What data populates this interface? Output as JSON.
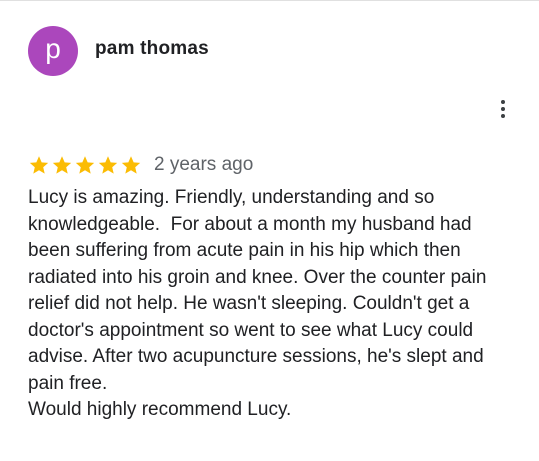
{
  "reviewer": {
    "avatar_letter": "p",
    "avatar_color": "#ab47bc",
    "name": "pam thomas"
  },
  "menu": {
    "icon": "more-vert-icon"
  },
  "review": {
    "rating": 5,
    "rating_max": 5,
    "star_color": "#fbbc04",
    "date": "2 years ago",
    "text": "Lucy is amazing. Friendly, understanding and so\nknowledgeable.  For about a month my husband had\nbeen suffering from acute pain in his hip which then\nradiated into his groin and knee. Over the counter pain\nrelief did not help. He wasn't sleeping. Couldn't get a\ndoctor's appointment so went to see what Lucy could\nadvise. After two acupuncture sessions, he's slept and\npain free.\nWould highly recommend Lucy."
  }
}
